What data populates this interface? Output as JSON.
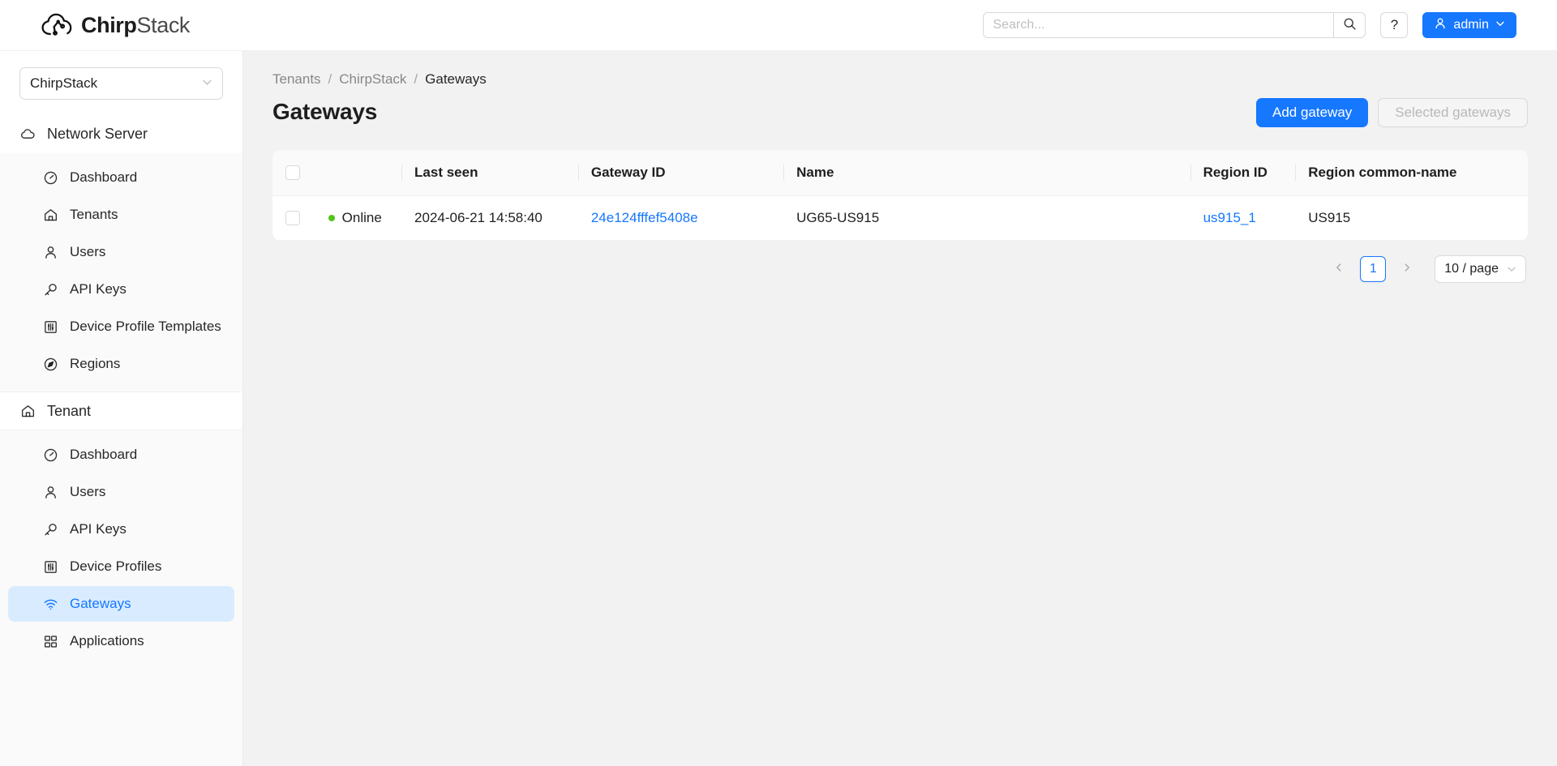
{
  "app": {
    "brand_bold": "Chirp",
    "brand_light": "Stack",
    "accent_color": "#1677ff",
    "status_online_color": "#52c41a"
  },
  "header": {
    "search_placeholder": "Search...",
    "search_value": "",
    "search_icon": "search-icon",
    "help_label": "?",
    "help_icon": "question-mark-icon",
    "user_label": "admin",
    "user_icon": "user-icon",
    "user_caret_icon": "chevron-down-icon"
  },
  "sidebar": {
    "tenant_selector": {
      "value": "ChirpStack",
      "caret_icon": "chevron-down-icon"
    },
    "groups": [
      {
        "label": "Network Server",
        "icon": "cloud-icon",
        "items": [
          {
            "label": "Dashboard",
            "icon": "dashboard-gauge-icon",
            "active": false
          },
          {
            "label": "Tenants",
            "icon": "home-icon",
            "active": false
          },
          {
            "label": "Users",
            "icon": "user-icon",
            "active": false
          },
          {
            "label": "API Keys",
            "icon": "key-icon",
            "active": false
          },
          {
            "label": "Device Profile Templates",
            "icon": "sliders-icon",
            "active": false
          },
          {
            "label": "Regions",
            "icon": "compass-icon",
            "active": false
          }
        ]
      },
      {
        "label": "Tenant",
        "icon": "home-icon",
        "items": [
          {
            "label": "Dashboard",
            "icon": "dashboard-gauge-icon",
            "active": false
          },
          {
            "label": "Users",
            "icon": "user-icon",
            "active": false
          },
          {
            "label": "API Keys",
            "icon": "key-icon",
            "active": false
          },
          {
            "label": "Device Profiles",
            "icon": "sliders-icon",
            "active": false
          },
          {
            "label": "Gateways",
            "icon": "wifi-icon",
            "active": true
          },
          {
            "label": "Applications",
            "icon": "apps-grid-icon",
            "active": false
          }
        ]
      }
    ]
  },
  "main": {
    "breadcrumb": [
      {
        "label": "Tenants",
        "current": false
      },
      {
        "label": "ChirpStack",
        "current": false
      },
      {
        "label": "Gateways",
        "current": true
      }
    ],
    "breadcrumb_separator": "/",
    "page_title": "Gateways",
    "actions": {
      "add_gateway_label": "Add gateway",
      "selected_gateways_label": "Selected gateways"
    },
    "table": {
      "columns": [
        {
          "key": "select",
          "label": ""
        },
        {
          "key": "status",
          "label": ""
        },
        {
          "key": "last_seen",
          "label": "Last seen"
        },
        {
          "key": "gateway_id",
          "label": "Gateway ID"
        },
        {
          "key": "name",
          "label": "Name"
        },
        {
          "key": "region_id",
          "label": "Region ID"
        },
        {
          "key": "region_common_name",
          "label": "Region common-name"
        }
      ],
      "rows": [
        {
          "selected": false,
          "status": "Online",
          "last_seen": "2024-06-21 14:58:40",
          "gateway_id": "24e124fffef5408e",
          "name": "UG65-US915",
          "region_id": "us915_1",
          "region_common_name": "US915"
        }
      ]
    },
    "pagination": {
      "prev_icon": "chevron-left-icon",
      "next_icon": "chevron-right-icon",
      "current_page": "1",
      "page_size_label": "10 / page",
      "page_size_caret_icon": "chevron-down-icon"
    }
  }
}
